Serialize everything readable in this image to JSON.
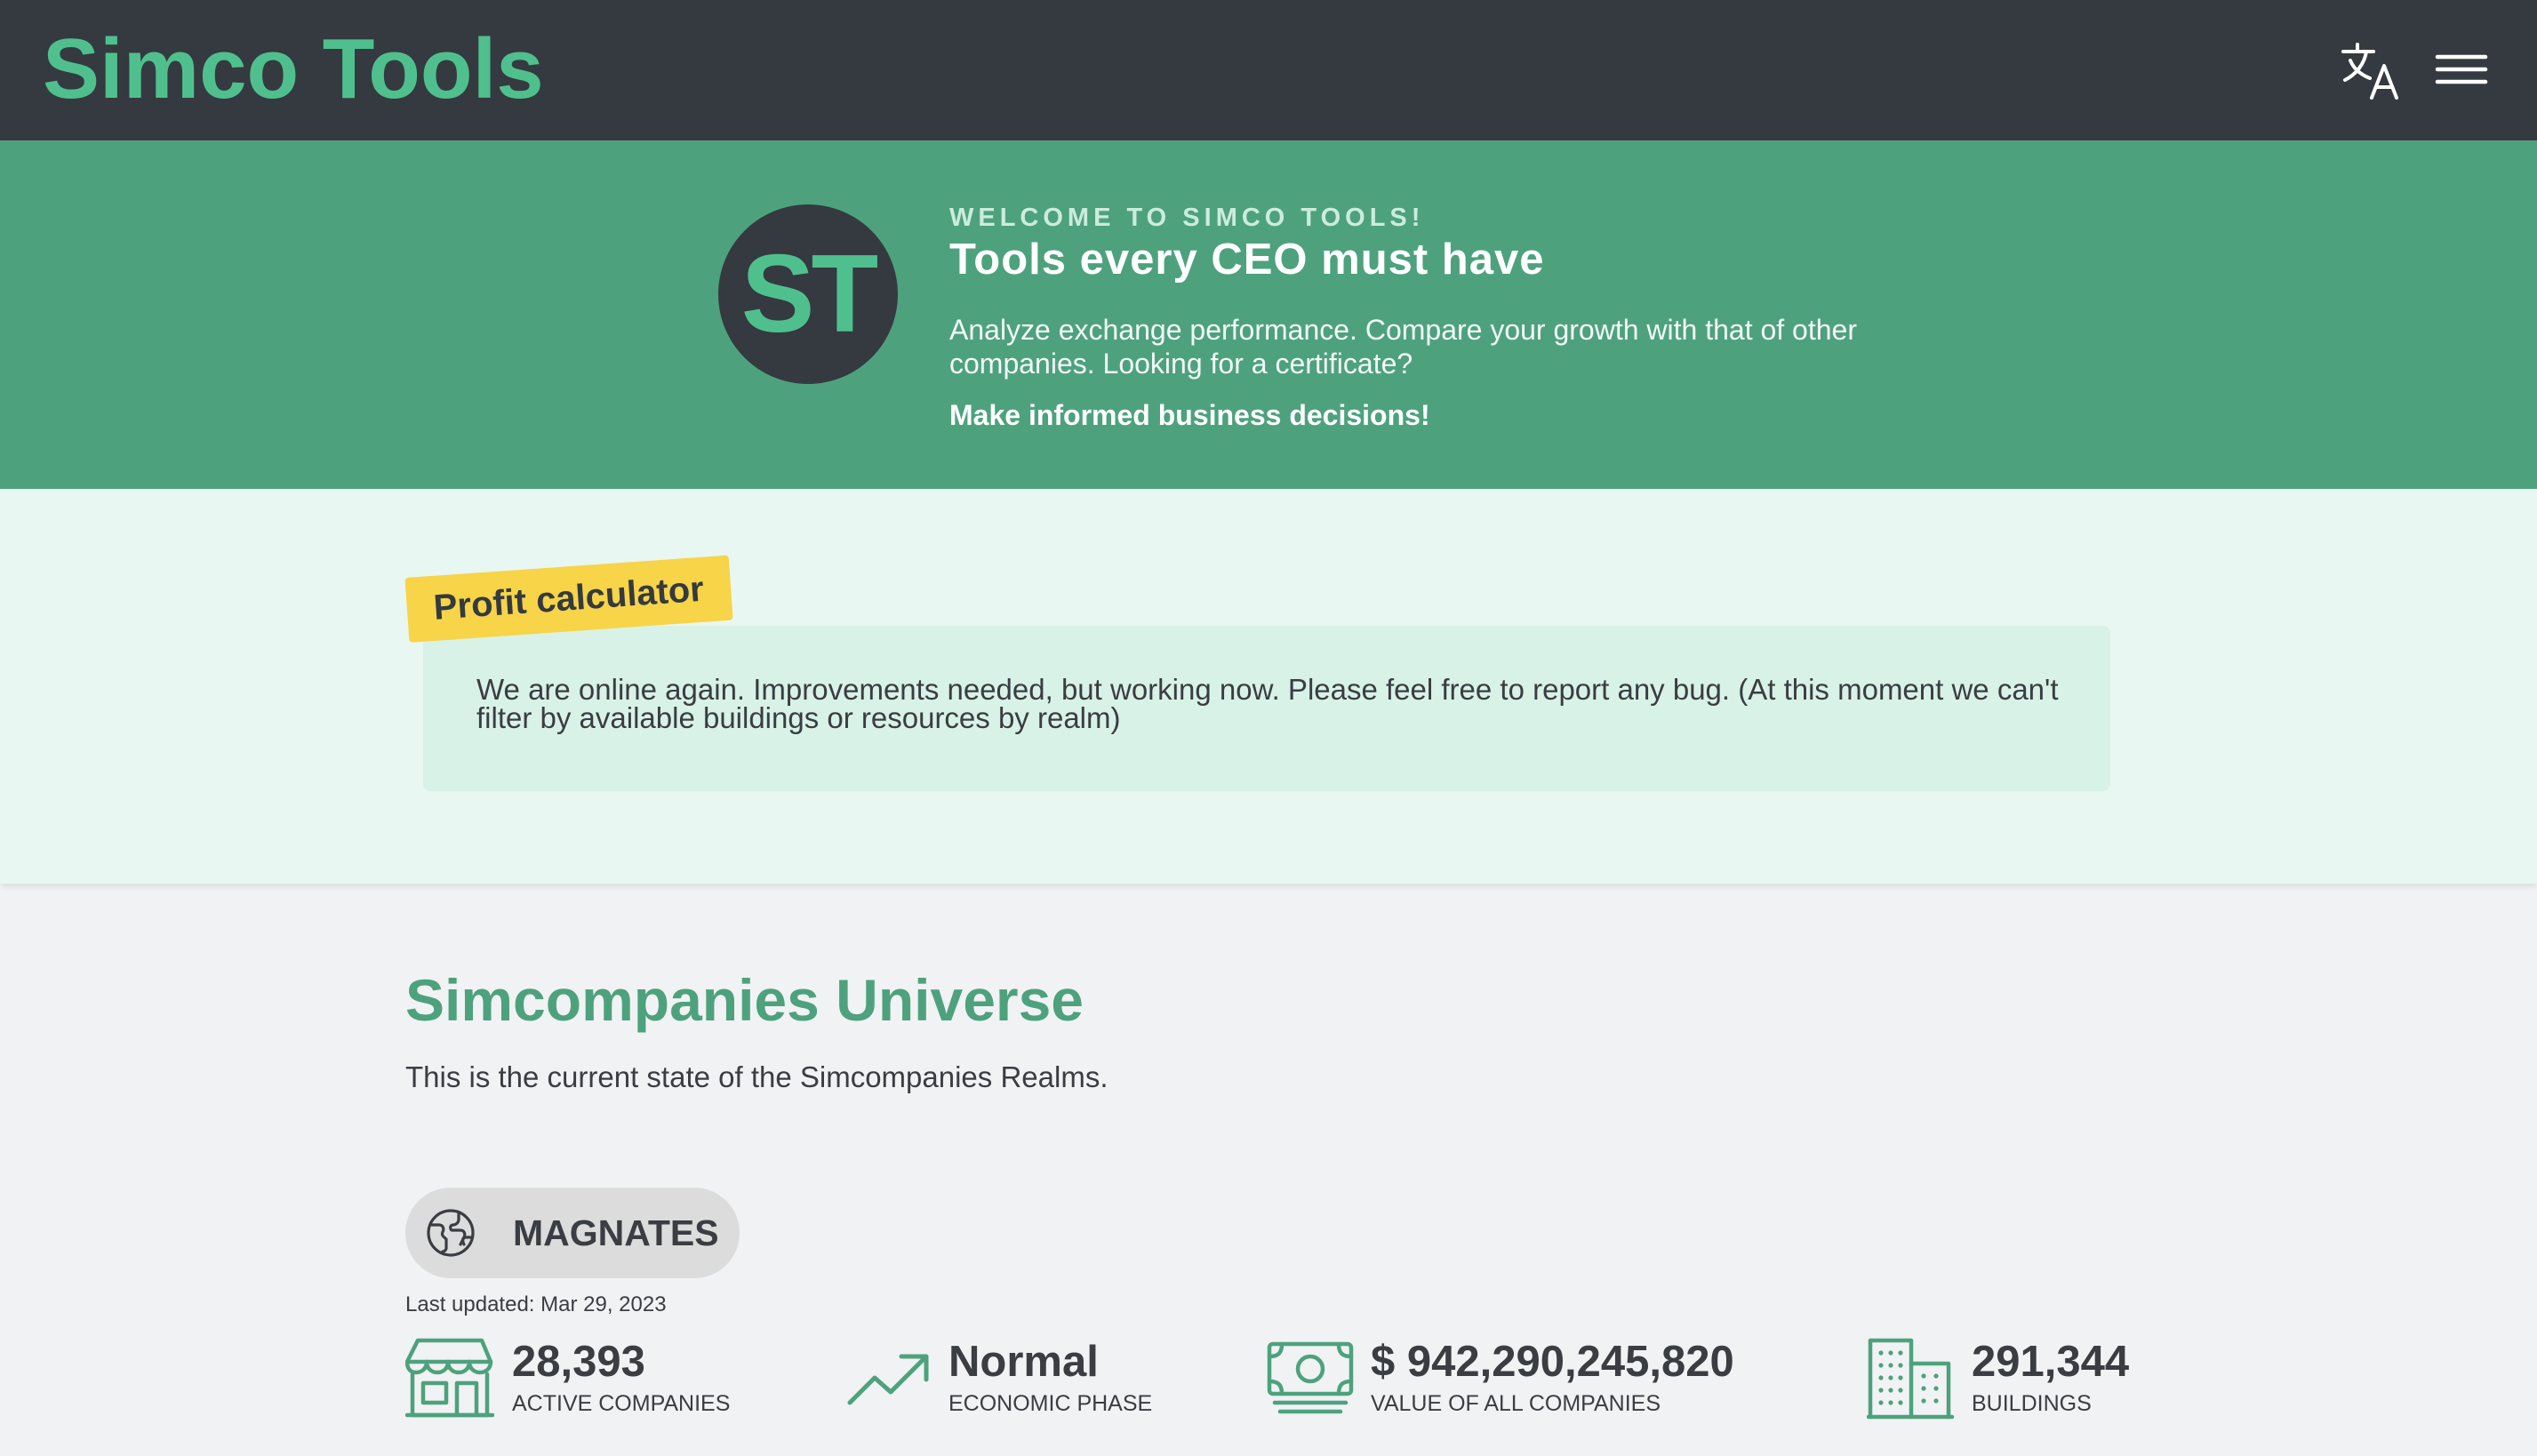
{
  "header": {
    "brand": "Simco Tools",
    "icons": [
      "translate-icon",
      "menu-icon"
    ]
  },
  "hero": {
    "logo_text": "ST",
    "kicker": "WELCOME TO SIMCO TOOLS!",
    "title": "Tools every CEO must have",
    "description": "Analyze exchange performance. Compare your growth with that of other companies. Looking for a certificate?",
    "cta": "Make informed business decisions!"
  },
  "notice": {
    "tag": "Profit calculator",
    "text": "We are online again. Improvements needed, but working now. Please feel free to report any bug. (At this moment we can't filter by available buildings or resources by realm)"
  },
  "universe": {
    "title": "Simcompanies Universe",
    "subtitle": "This is the current state of the Simcompanies Realms.",
    "realm": "MAGNATES",
    "last_updated": "Last updated: Mar 29, 2023",
    "stats": [
      {
        "icon": "store-icon",
        "value": "28,393",
        "label": "ACTIVE COMPANIES"
      },
      {
        "icon": "trending-up-icon",
        "value": "Normal",
        "label": "ECONOMIC PHASE"
      },
      {
        "icon": "cash-icon",
        "value": "$ 942,290,245,820",
        "label": "VALUE OF ALL COMPANIES"
      },
      {
        "icon": "building-icon",
        "value": "291,344",
        "label": "BUILDINGS"
      }
    ]
  },
  "colors": {
    "topbar": "#343a3f",
    "brand": "#4fc08d",
    "hero": "#4da27d",
    "notice_bg": "#e8f7f1",
    "notice_card": "#d8f2e7",
    "tag": "#f7d448",
    "page_bg": "#f1f2f4"
  }
}
